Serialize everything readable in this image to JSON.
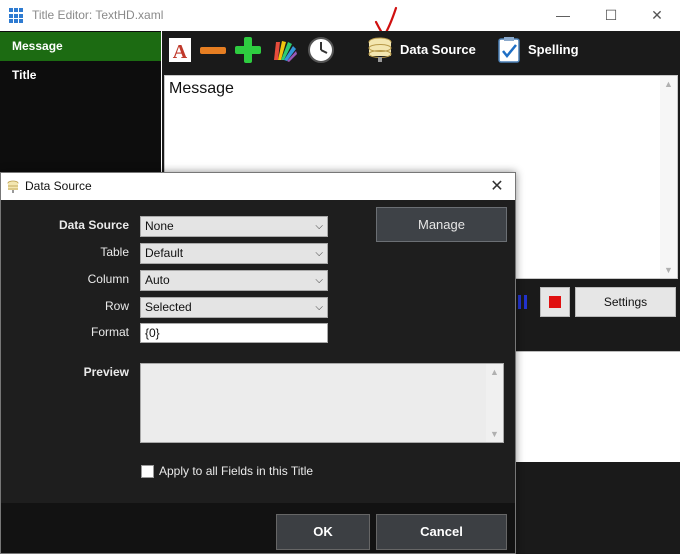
{
  "window": {
    "title": "Title Editor: TextHD.xaml",
    "minimize": "—",
    "maximize": "☐",
    "close": "✕"
  },
  "sidebar": {
    "items": [
      {
        "label": "Message",
        "active": true
      },
      {
        "label": "Title",
        "active": false
      }
    ]
  },
  "toolbar": {
    "font_icon": "font-icon",
    "remove_icon": "minus-icon",
    "add_icon": "plus-icon",
    "color_icon": "color-palette-icon",
    "clock_icon": "clock-icon",
    "data_source_icon": "database-icon",
    "data_source_label": "Data Source",
    "spelling_icon": "spellcheck-icon",
    "spelling_label": "Spelling"
  },
  "editor": {
    "text": "Message"
  },
  "controls": {
    "pause_icon": "pause-icon",
    "stop_icon": "stop-icon",
    "settings_label": "Settings"
  },
  "dialog": {
    "title": "Data Source",
    "close": "✕",
    "fields": {
      "data_source": {
        "label": "Data Source",
        "value": "None"
      },
      "table": {
        "label": "Table",
        "value": "Default"
      },
      "column": {
        "label": "Column",
        "value": "Auto"
      },
      "row": {
        "label": "Row",
        "value": "Selected"
      },
      "format": {
        "label": "Format",
        "value": "{0}"
      }
    },
    "manage_label": "Manage",
    "preview_label": "Preview",
    "preview_value": "",
    "apply_label": "Apply to all Fields in this Title",
    "apply_checked": false,
    "ok_label": "OK",
    "cancel_label": "Cancel"
  },
  "colors": {
    "sidebar_active": "#1c6b12",
    "dark_panel": "#1a1a1a",
    "stop_red": "#e01010",
    "pause_blue": "#2233cc",
    "annotation_red": "#d01010"
  }
}
